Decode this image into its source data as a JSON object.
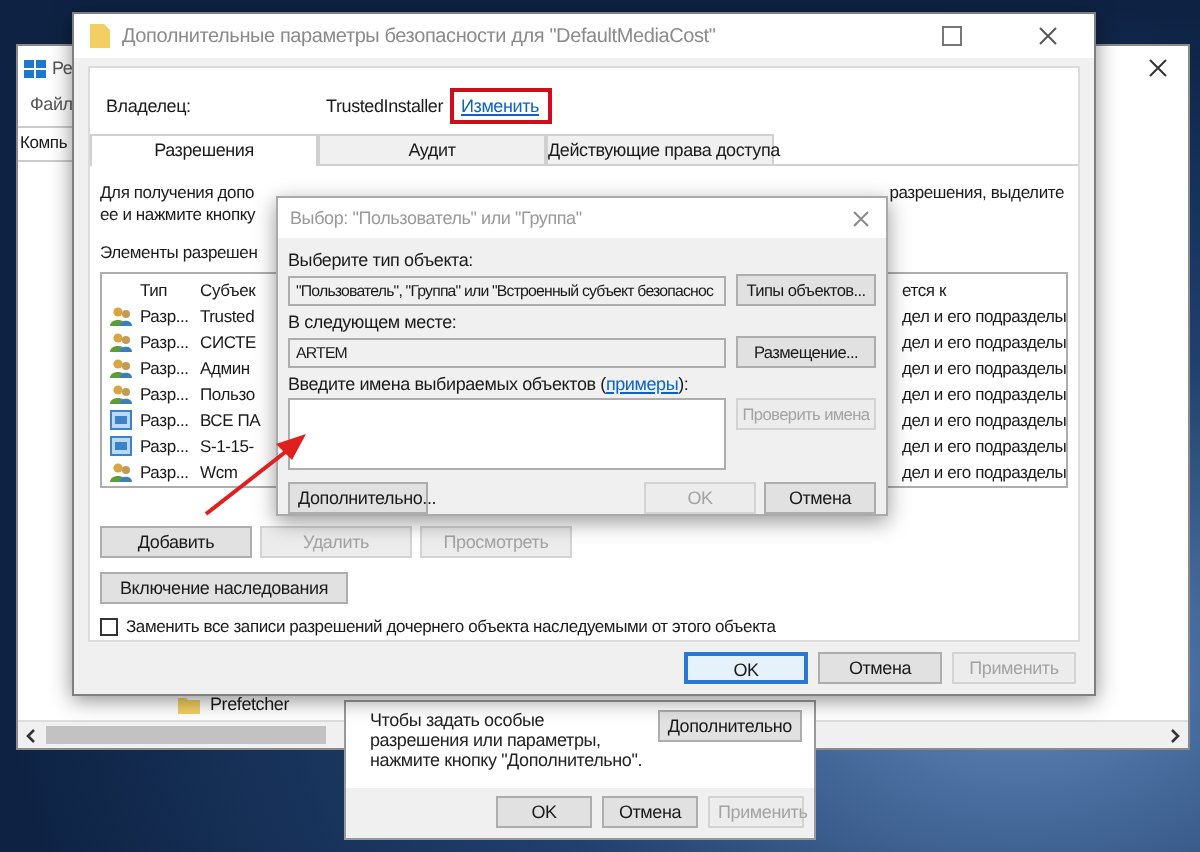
{
  "back_window": {
    "title": "Ре",
    "menu": [
      "Файл"
    ],
    "header": "Компь",
    "tree_item": "Prefetcher"
  },
  "permissions_dialog": {
    "note": "Чтобы задать особые разрешения или параметры, нажмите кнопку \"Дополнительно\".",
    "advanced_button": "Дополнительно",
    "buttons": [
      {
        "label": "OK",
        "disabled": false
      },
      {
        "label": "Отмена",
        "disabled": false
      },
      {
        "label": "Применить",
        "disabled": true
      }
    ]
  },
  "security_dialog": {
    "title": "Дополнительные параметры безопасности  для \"DefaultMediaCost\"",
    "owner_label": "Владелец:",
    "owner": "TrustedInstaller",
    "change_link": "Изменить",
    "tabs": [
      {
        "label": "Разрешения",
        "selected": true
      },
      {
        "label": "Аудит",
        "selected": false
      },
      {
        "label": "Действующие права доступа",
        "selected": false
      }
    ],
    "intro_left": [
      "Для получения допо",
      "ее и нажмите кнопку"
    ],
    "intro_right": "разрешения, выделите",
    "entries_label": "Элементы разрешен",
    "table": {
      "columns": [
        "Тип",
        "Субъек"
      ],
      "column_3": "ется к",
      "rows": [
        {
          "kind": "group",
          "type": "Разр...",
          "subject": "Trusted",
          "applies": "дел и его подразделы"
        },
        {
          "kind": "group",
          "type": "Разр...",
          "subject": "СИСТЕ",
          "applies": "дел и его подразделы"
        },
        {
          "kind": "group",
          "type": "Разр...",
          "subject": "Админ",
          "applies": "дел и его подразделы"
        },
        {
          "kind": "group",
          "type": "Разр...",
          "subject": "Пользо",
          "applies": "дел и его подразделы"
        },
        {
          "kind": "package",
          "type": "Разр...",
          "subject": "ВСЕ ПА",
          "applies": "дел и его подразделы"
        },
        {
          "kind": "package",
          "type": "Разр...",
          "subject": "S-1-15-",
          "applies": "дел и его подразделы"
        },
        {
          "kind": "group",
          "type": "Разр...",
          "subject": "Wcm",
          "applies": "дел и его подразделы"
        }
      ]
    },
    "list_buttons": [
      {
        "label": "Добавить",
        "disabled": false
      },
      {
        "label": "Удалить",
        "disabled": true
      },
      {
        "label": "Просмотреть",
        "disabled": true
      }
    ],
    "inherit_button": "Включение наследования",
    "replace_checkbox": {
      "label": "Заменить все записи разрешений дочернего объекта наследуемыми от этого объекта",
      "checked": false
    },
    "buttons": [
      {
        "label": "OK",
        "disabled": false,
        "focused": true
      },
      {
        "label": "Отмена",
        "disabled": false,
        "focused": false
      },
      {
        "label": "Применить",
        "disabled": true,
        "focused": false
      }
    ]
  },
  "select_dialog": {
    "title": "Выбор: \"Пользователь\" или \"Группа\"",
    "type_label": "Выберите тип объекта:",
    "type_value": "\"Пользователь\", \"Группа\" или \"Встроенный субъект безопаснос",
    "types_button": "Типы объектов...",
    "location_label": "В следующем месте:",
    "location_value": "ARTEM",
    "location_button": "Размещение...",
    "names_label": "Введите имена выбираемых объектов (",
    "names_link": "примеры",
    "names_label_end": "):",
    "check_button": {
      "label": "Проверить имена",
      "disabled": true
    },
    "advanced_button": "Дополнительно...",
    "buttons": [
      {
        "label": "OK",
        "disabled": true
      },
      {
        "label": "Отмена",
        "disabled": false
      }
    ]
  }
}
